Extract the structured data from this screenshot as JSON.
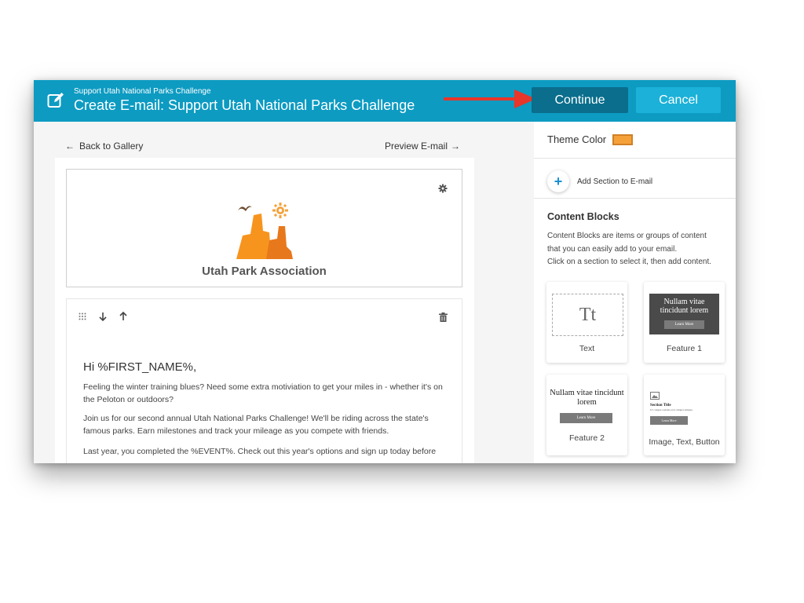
{
  "header": {
    "subtitle": "Support Utah National Parks Challenge",
    "title": "Create E-mail: Support Utah National Parks Challenge",
    "continue_label": "Continue",
    "cancel_label": "Cancel",
    "color": "#0d9bc2",
    "arrow_color": "#e8362a"
  },
  "editor": {
    "back_label": "Back to Gallery",
    "preview_label": "Preview E-mail",
    "org_name": "Utah Park Association",
    "greeting": "Hi %FIRST_NAME%,",
    "paragraphs": [
      "Feeling the winter training blues? Need some extra motiviation to get your miles in - whether it's on the Peloton or outdoors?",
      "Join us for our second annual Utah National Parks Challenge! We'll be riding across the state's famous parks. Earn milestones and track your mileage as you compete with friends.",
      "Last year, you completed the %EVENT%. Check out this year's options and sign up today before"
    ]
  },
  "panel": {
    "theme_color_label": "Theme Color",
    "theme_color": "#f5a13a",
    "add_section_label": "Add Section to E-mail",
    "content_blocks_title": "Content Blocks",
    "content_blocks_desc": [
      "Content Blocks are items or groups of content",
      "that you can easily add to your email.",
      "Click on a section to select it, then add content."
    ],
    "cards": [
      {
        "label": "Text",
        "preview": "Tt"
      },
      {
        "label": "Feature 1",
        "preview_text": "Nullam vitae tincidunt lorem",
        "preview_button": "Learn More"
      },
      {
        "label": "Feature 2",
        "preview_text": "Nullam vitae tincidunt lorem",
        "preview_button": "Learn More"
      },
      {
        "label": "Image, Text, Button",
        "preview_title": "Section Title",
        "preview_body": "Ut congue sodales eros aliquet tempus.",
        "preview_button": "Learn More"
      }
    ]
  }
}
